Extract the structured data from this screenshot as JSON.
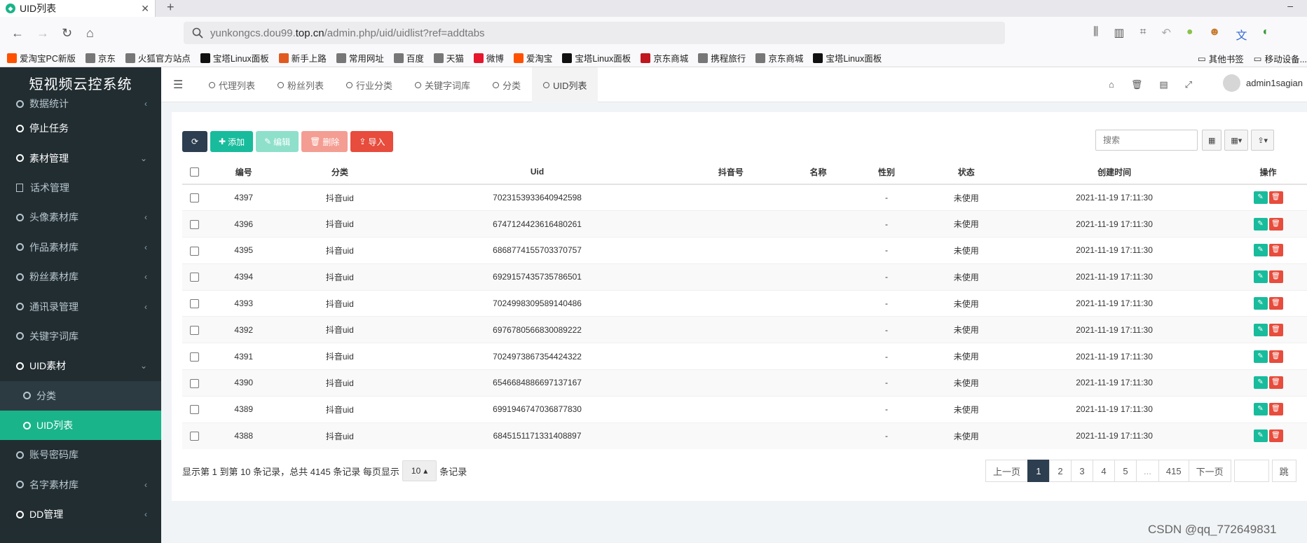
{
  "browser": {
    "tab_title": "UID列表",
    "url_prefix": "yunkongcs.dou99.",
    "url_domain": "top.cn",
    "url_path": "/admin.php/uid/uidlist?ref=addtabs",
    "bookmarks": [
      {
        "label": "爱淘宝PC新版",
        "color": "#ff5000"
      },
      {
        "label": "京东",
        "color": "#777"
      },
      {
        "label": "火狐官方站点",
        "color": "#777"
      },
      {
        "label": "宝塔Linux面板",
        "color": "#111"
      },
      {
        "label": "新手上路",
        "color": "#e25920"
      },
      {
        "label": "常用网址",
        "color": "#777"
      },
      {
        "label": "百度",
        "color": "#777"
      },
      {
        "label": "天猫",
        "color": "#777"
      },
      {
        "label": "微博",
        "color": "#e6162d"
      },
      {
        "label": "爱淘宝",
        "color": "#ff5000"
      },
      {
        "label": "宝塔Linux面板",
        "color": "#111"
      },
      {
        "label": "京东商城",
        "color": "#c0161d"
      },
      {
        "label": "携程旅行",
        "color": "#777"
      },
      {
        "label": "京东商城",
        "color": "#777"
      },
      {
        "label": "宝塔Linux面板",
        "color": "#111"
      }
    ],
    "bookmarks_right": [
      "其他书签",
      "移动设备..."
    ]
  },
  "app": {
    "brand": "短视频云控系统",
    "user": "admin1sagian",
    "accent": "#19b48a"
  },
  "sidebar": {
    "items": [
      {
        "label": "数据统计",
        "icon": "ring",
        "arrow": "‹",
        "cls": "first"
      },
      {
        "label": "停止任务",
        "icon": "ring",
        "arrow": "",
        "cls": "white"
      },
      {
        "label": "素材管理",
        "icon": "ring",
        "arrow": "⌄",
        "cls": "white"
      },
      {
        "label": "话术管理",
        "icon": "doc",
        "arrow": "",
        "cls": ""
      },
      {
        "label": "头像素材库",
        "icon": "ring",
        "arrow": "‹",
        "cls": ""
      },
      {
        "label": "作品素材库",
        "icon": "ring",
        "arrow": "‹",
        "cls": ""
      },
      {
        "label": "粉丝素材库",
        "icon": "ring",
        "arrow": "‹",
        "cls": ""
      },
      {
        "label": "通讯录管理",
        "icon": "ring",
        "arrow": "‹",
        "cls": ""
      },
      {
        "label": "关键字词库",
        "icon": "ring",
        "arrow": "",
        "cls": ""
      },
      {
        "label": "UID素材",
        "icon": "ring",
        "arrow": "⌄",
        "cls": "white"
      },
      {
        "label": "分类",
        "icon": "ring",
        "arrow": "",
        "cls": "sub"
      },
      {
        "label": "UID列表",
        "icon": "ring",
        "arrow": "",
        "cls": "sub active"
      },
      {
        "label": "账号密码库",
        "icon": "ring",
        "arrow": "",
        "cls": ""
      },
      {
        "label": "名字素材库",
        "icon": "ring",
        "arrow": "‹",
        "cls": ""
      },
      {
        "label": "DD管理",
        "icon": "ring",
        "arrow": "‹",
        "cls": "white"
      }
    ]
  },
  "apptabs": [
    {
      "label": "代理列表",
      "active": false
    },
    {
      "label": "粉丝列表",
      "active": false
    },
    {
      "label": "行业分类",
      "active": false
    },
    {
      "label": "关键字词库",
      "active": false
    },
    {
      "label": "分类",
      "active": false
    },
    {
      "label": "UID列表",
      "active": true
    }
  ],
  "toolbar": {
    "add": "添加",
    "edit": "编辑",
    "delete": "删除",
    "import": "导入",
    "search_placeholder": "搜索"
  },
  "table": {
    "headers": [
      "编号",
      "分类",
      "Uid",
      "抖音号",
      "名称",
      "性别",
      "状态",
      "创建时间",
      "操作"
    ],
    "rows": [
      [
        "4397",
        "抖音uid",
        "7023153933640942598",
        "",
        "",
        "-",
        "未使用",
        "2021-11-19 17:11:30"
      ],
      [
        "4396",
        "抖音uid",
        "6747124423616480261",
        "",
        "",
        "-",
        "未使用",
        "2021-11-19 17:11:30"
      ],
      [
        "4395",
        "抖音uid",
        "6868774155703370757",
        "",
        "",
        "-",
        "未使用",
        "2021-11-19 17:11:30"
      ],
      [
        "4394",
        "抖音uid",
        "6929157435735786501",
        "",
        "",
        "-",
        "未使用",
        "2021-11-19 17:11:30"
      ],
      [
        "4393",
        "抖音uid",
        "7024998309589140486",
        "",
        "",
        "-",
        "未使用",
        "2021-11-19 17:11:30"
      ],
      [
        "4392",
        "抖音uid",
        "6976780566830089222",
        "",
        "",
        "-",
        "未使用",
        "2021-11-19 17:11:30"
      ],
      [
        "4391",
        "抖音uid",
        "7024973867354424322",
        "",
        "",
        "-",
        "未使用",
        "2021-11-19 17:11:30"
      ],
      [
        "4390",
        "抖音uid",
        "6546684886697137167",
        "",
        "",
        "-",
        "未使用",
        "2021-11-19 17:11:30"
      ],
      [
        "4389",
        "抖音uid",
        "6991946747036877830",
        "",
        "",
        "-",
        "未使用",
        "2021-11-19 17:11:30"
      ],
      [
        "4388",
        "抖音uid",
        "6845151171331408897",
        "",
        "",
        "-",
        "未使用",
        "2021-11-19 17:11:30"
      ]
    ]
  },
  "footer": {
    "summary": "显示第 1 到第 10 条记录，总共 4145 条记录 每页显示",
    "page_size": "10",
    "suffix": "条记录"
  },
  "pagination": {
    "prev": "上一页",
    "pages": [
      "1",
      "2",
      "3",
      "4",
      "5",
      "...",
      "415"
    ],
    "active": "1",
    "next": "下一页",
    "jump": "跳"
  },
  "watermark": "CSDN @qq_772649831"
}
